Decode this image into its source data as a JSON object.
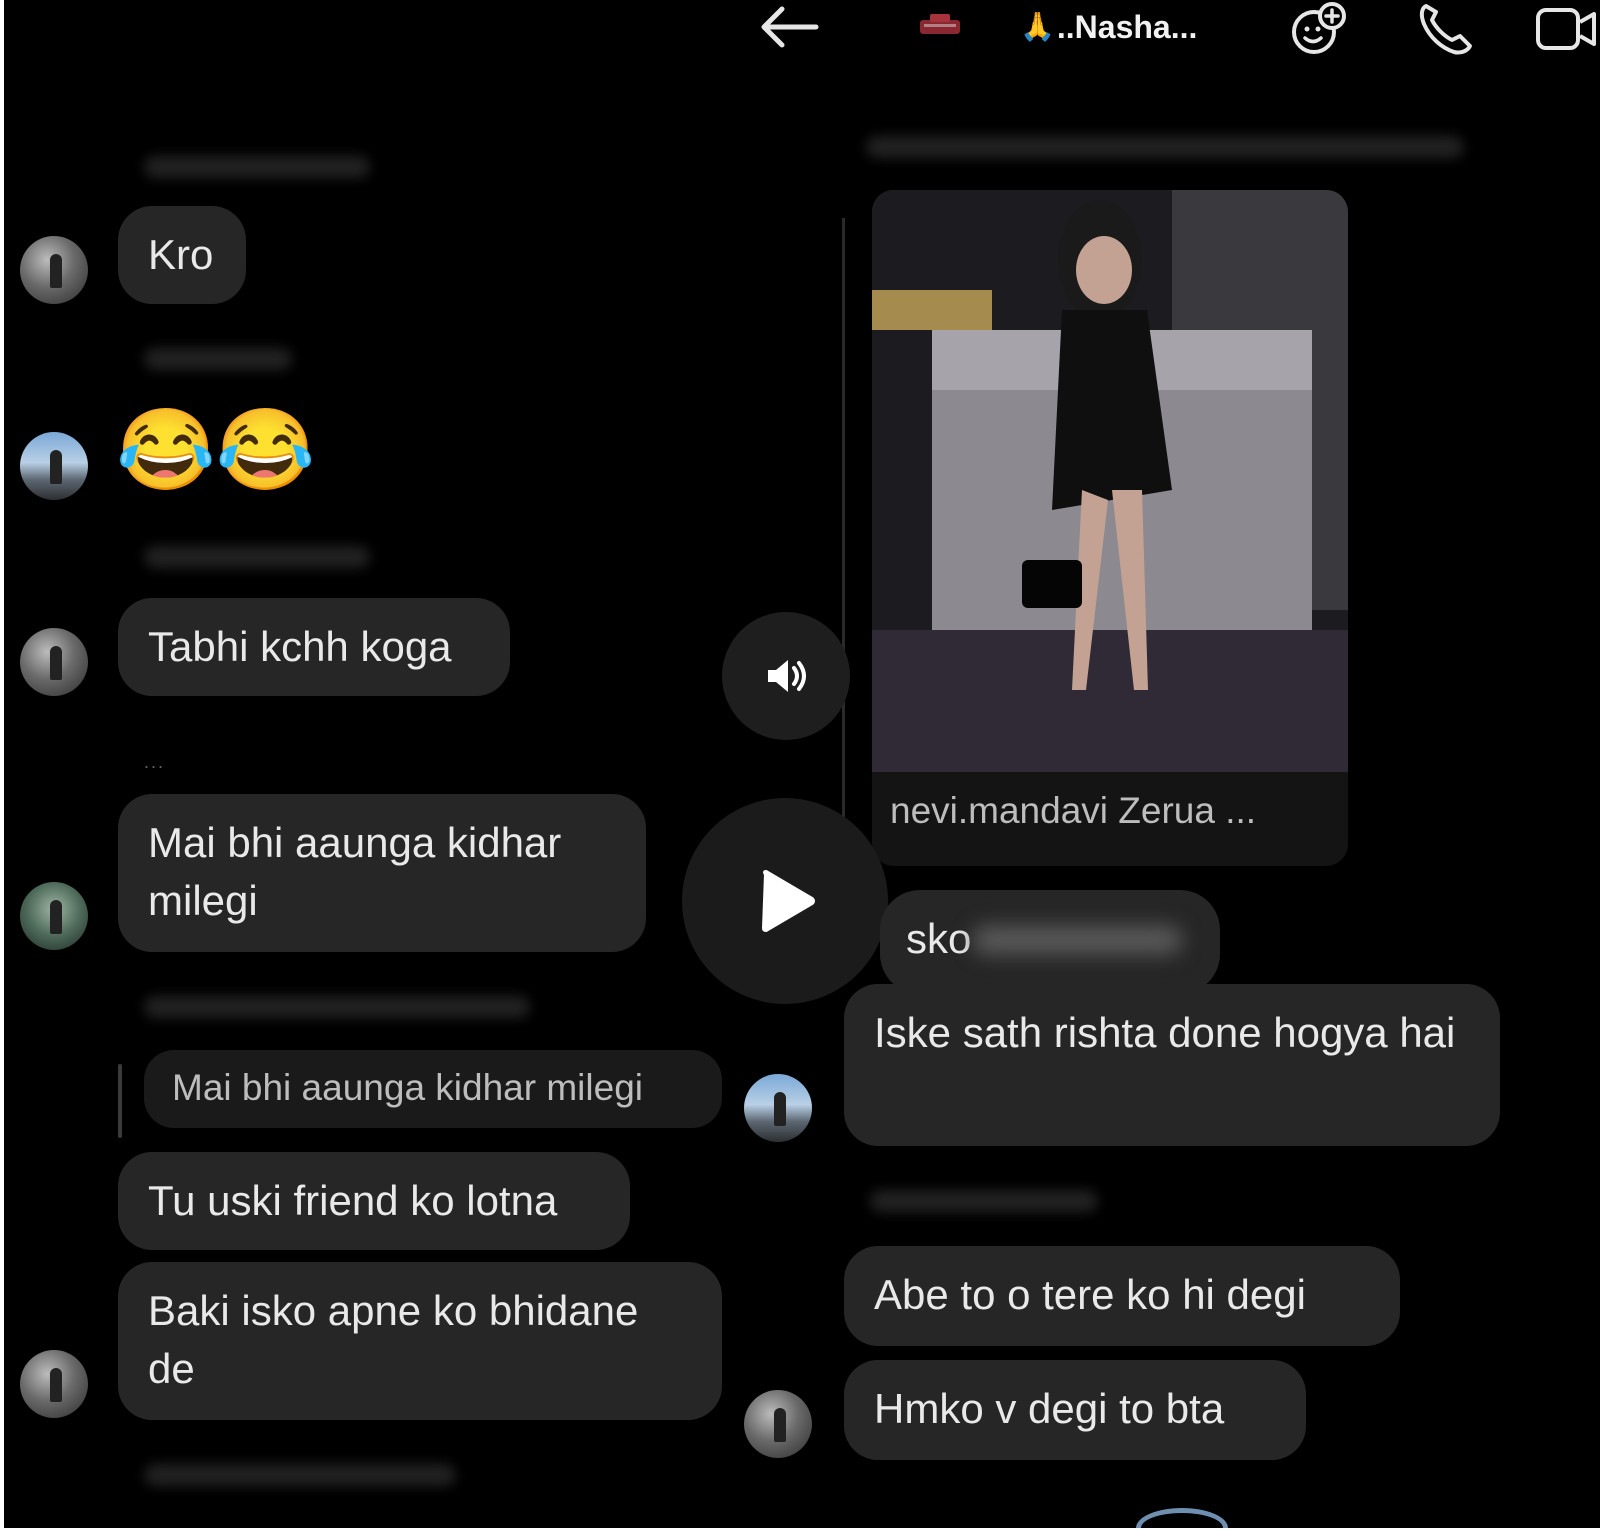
{
  "header": {
    "title": "..Nasha...",
    "title_emoji": "🙏"
  },
  "messages_left": {
    "m1": "Kro",
    "m2_emoji": "😂😂",
    "m3": "Tabhi kchh koga",
    "typing": "...",
    "m4": "Mai bhi aaunga kidhar milegi",
    "reply_quote": "Mai bhi aaunga kidhar milegi",
    "m5": "Tu uski friend ko lotna",
    "m6": "Baki isko apne ko bhidane de"
  },
  "post": {
    "caption": "nevi.mandavi Zerua ..."
  },
  "messages_right": {
    "reply_preview": "sko",
    "r1": "Iske sath rishta done hogya hai",
    "r2": "Abe to o tere ko hi degi",
    "r3": "Hmko v degi to bta"
  },
  "icons": {
    "back": "back-arrow-icon",
    "sticker": "sticker-icon",
    "call": "phone-icon",
    "video": "video-icon",
    "sound": "speaker-icon",
    "play": "play-icon"
  }
}
